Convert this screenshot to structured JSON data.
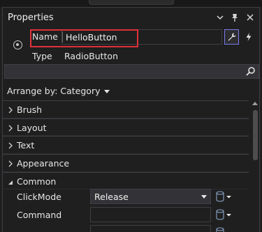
{
  "window": {
    "title": "Properties"
  },
  "header": {
    "name_label": "Name",
    "name_value": "HelloButton",
    "type_label": "Type",
    "type_value": "RadioButton",
    "search_placeholder": ""
  },
  "arrange": {
    "label": "Arrange by: Category"
  },
  "categories": [
    {
      "label": "Brush",
      "expanded": false
    },
    {
      "label": "Layout",
      "expanded": false
    },
    {
      "label": "Text",
      "expanded": false
    },
    {
      "label": "Appearance",
      "expanded": false
    },
    {
      "label": "Common",
      "expanded": true
    }
  ],
  "properties": [
    {
      "label": "ClickMode",
      "value": "Release",
      "kind": "combo"
    },
    {
      "label": "Command",
      "value": "",
      "kind": "text"
    },
    {
      "label": "",
      "value": "",
      "kind": "text"
    }
  ],
  "colors": {
    "accent": "#7d7cf0",
    "highlight": "#e0303a",
    "background": "#1f1f1f"
  },
  "icons": {
    "dropdown": "chevron-down-icon",
    "pin": "pin-icon",
    "close": "close-icon",
    "target": "target-icon",
    "properties": "wrench-icon",
    "events": "lightning-icon",
    "search": "search-icon",
    "binding": "database-icon"
  }
}
